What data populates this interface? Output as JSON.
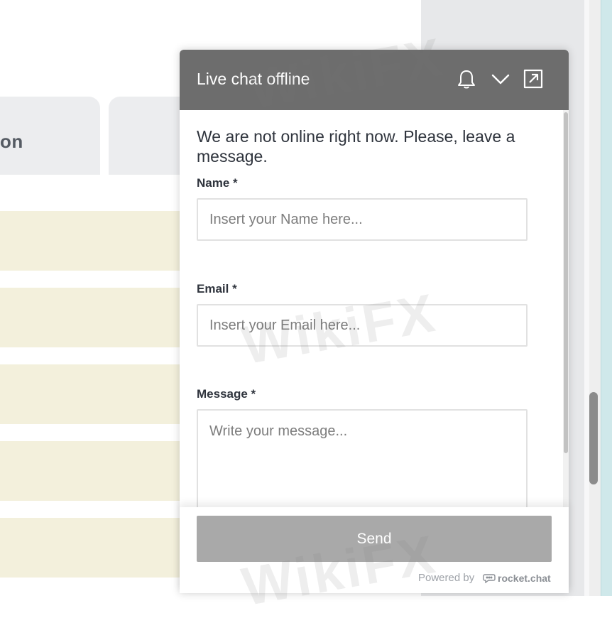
{
  "background": {
    "tab_label": "on"
  },
  "chat": {
    "title": "Live chat offline",
    "header_icons": [
      "bell-icon",
      "chevron-down-icon",
      "popout-icon"
    ],
    "intro_text": "We are not online right now. Please, leave a message.",
    "form": {
      "name_label": "Name *",
      "name_placeholder": "Insert your Name here...",
      "email_label": "Email *",
      "email_placeholder": "Insert your Email here...",
      "message_label": "Message *",
      "message_placeholder": "Write your message..."
    },
    "send_label": "Send",
    "powered_by": "Powered by",
    "brand": "rocket.chat"
  },
  "watermark": "WikiFX",
  "colors": {
    "header_bg": "#6d6d6d",
    "send_bg": "#a9a9a9",
    "row_highlight": "#f3f0dc"
  }
}
